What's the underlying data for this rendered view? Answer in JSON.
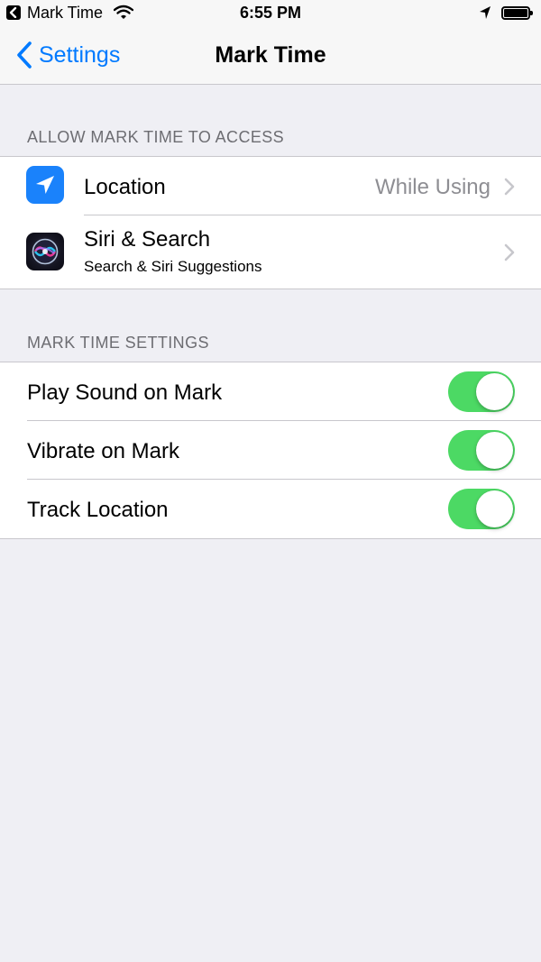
{
  "status_bar": {
    "back_app": "Mark Time",
    "time": "6:55 PM"
  },
  "nav": {
    "back_label": "Settings",
    "title": "Mark Time"
  },
  "sections": [
    {
      "header": "ALLOW MARK TIME TO ACCESS",
      "rows": [
        {
          "label": "Location",
          "value": "While Using",
          "icon": "location-arrow-icon"
        },
        {
          "label": "Siri & Search",
          "subtitle": "Search & Siri Suggestions",
          "icon": "siri-icon"
        }
      ]
    },
    {
      "header": "MARK TIME SETTINGS",
      "rows": [
        {
          "label": "Play Sound on Mark",
          "toggle_on": true
        },
        {
          "label": "Vibrate on Mark",
          "toggle_on": true
        },
        {
          "label": "Track Location",
          "toggle_on": true
        }
      ]
    }
  ],
  "colors": {
    "accent": "#007aff",
    "toggle_on": "#4cd964",
    "background": "#efeff4",
    "location_icon": "#1a82fb"
  }
}
